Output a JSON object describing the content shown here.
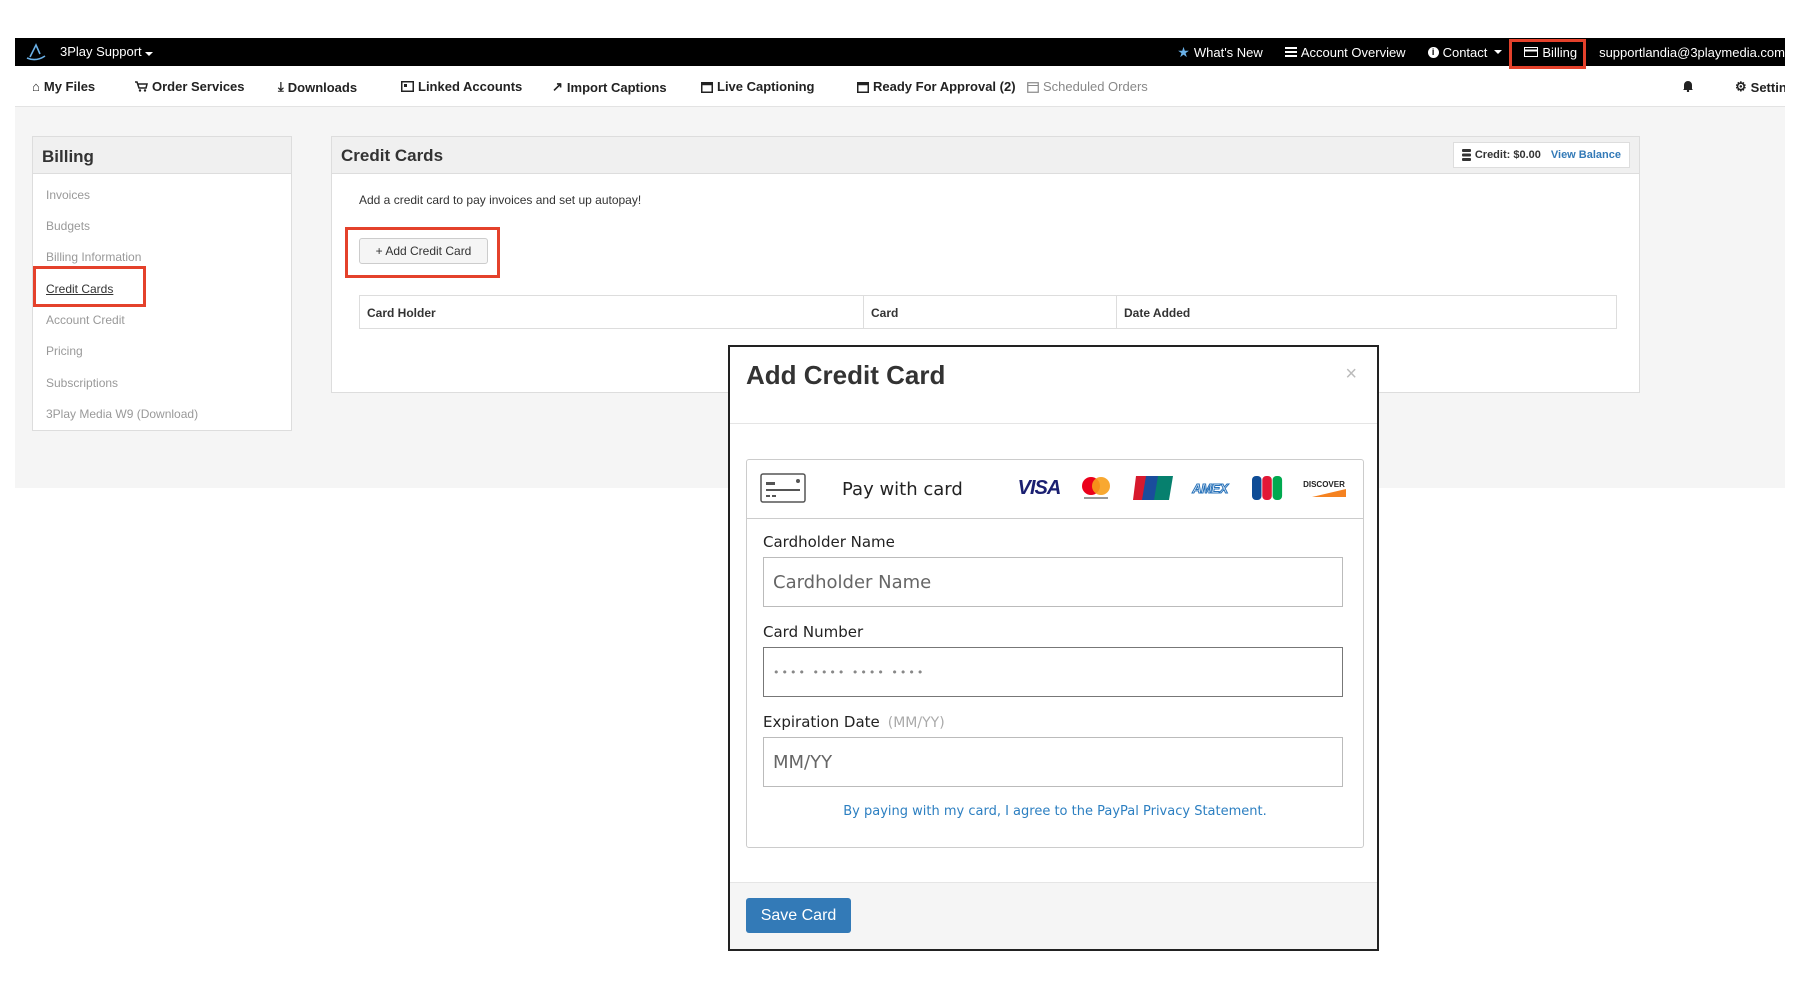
{
  "topbar": {
    "brand": "3Play Support",
    "whats_new": "What's New",
    "account_overview": "Account Overview",
    "contact": "Contact",
    "billing": "Billing",
    "user_email": "supportlandia@3playmedia.com"
  },
  "subnav": {
    "my_files": "My Files",
    "order_services": "Order Services",
    "downloads": "Downloads",
    "linked_accounts": "Linked Accounts",
    "import_captions": "Import Captions",
    "live_captioning": "Live Captioning",
    "ready_for_approval": "Ready For Approval (2)",
    "scheduled_orders": "Scheduled Orders",
    "settings": "Settings"
  },
  "sidebar": {
    "title": "Billing",
    "items": [
      {
        "label": "Invoices"
      },
      {
        "label": "Budgets"
      },
      {
        "label": "Billing Information"
      },
      {
        "label": "Credit Cards"
      },
      {
        "label": "Account Credit"
      },
      {
        "label": "Pricing"
      },
      {
        "label": "Subscriptions"
      },
      {
        "label": "3Play Media W9 (Download)"
      }
    ]
  },
  "panel": {
    "title": "Credit Cards",
    "credit": "Credit: $0.00",
    "view_balance": "View Balance",
    "intro": "Add a credit card to pay invoices and set up autopay!",
    "add_button": "+ Add Credit Card",
    "table_headers": [
      "Card Holder",
      "Card",
      "Date Added"
    ]
  },
  "modal": {
    "title": "Add Credit Card",
    "close": "×",
    "pay_with_card": "Pay with card",
    "brands": [
      "VISA",
      "Mastercard",
      "UnionPay",
      "AMEX",
      "JCB",
      "DISCOVER"
    ],
    "cardholder_label": "Cardholder Name",
    "cardholder_placeholder": "Cardholder Name",
    "card_number_label": "Card Number",
    "card_number_placeholder": "•••• •••• •••• ••••",
    "expiration_label": "Expiration Date",
    "expiration_hint": "(MM/YY)",
    "expiration_placeholder": "MM/YY",
    "agree_text": "By paying with my card, I agree to the PayPal Privacy Statement.",
    "save_button": "Save Card"
  },
  "colors": {
    "highlight": "#e4412b",
    "primary": "#337ab7",
    "link": "#2c7fc1"
  }
}
